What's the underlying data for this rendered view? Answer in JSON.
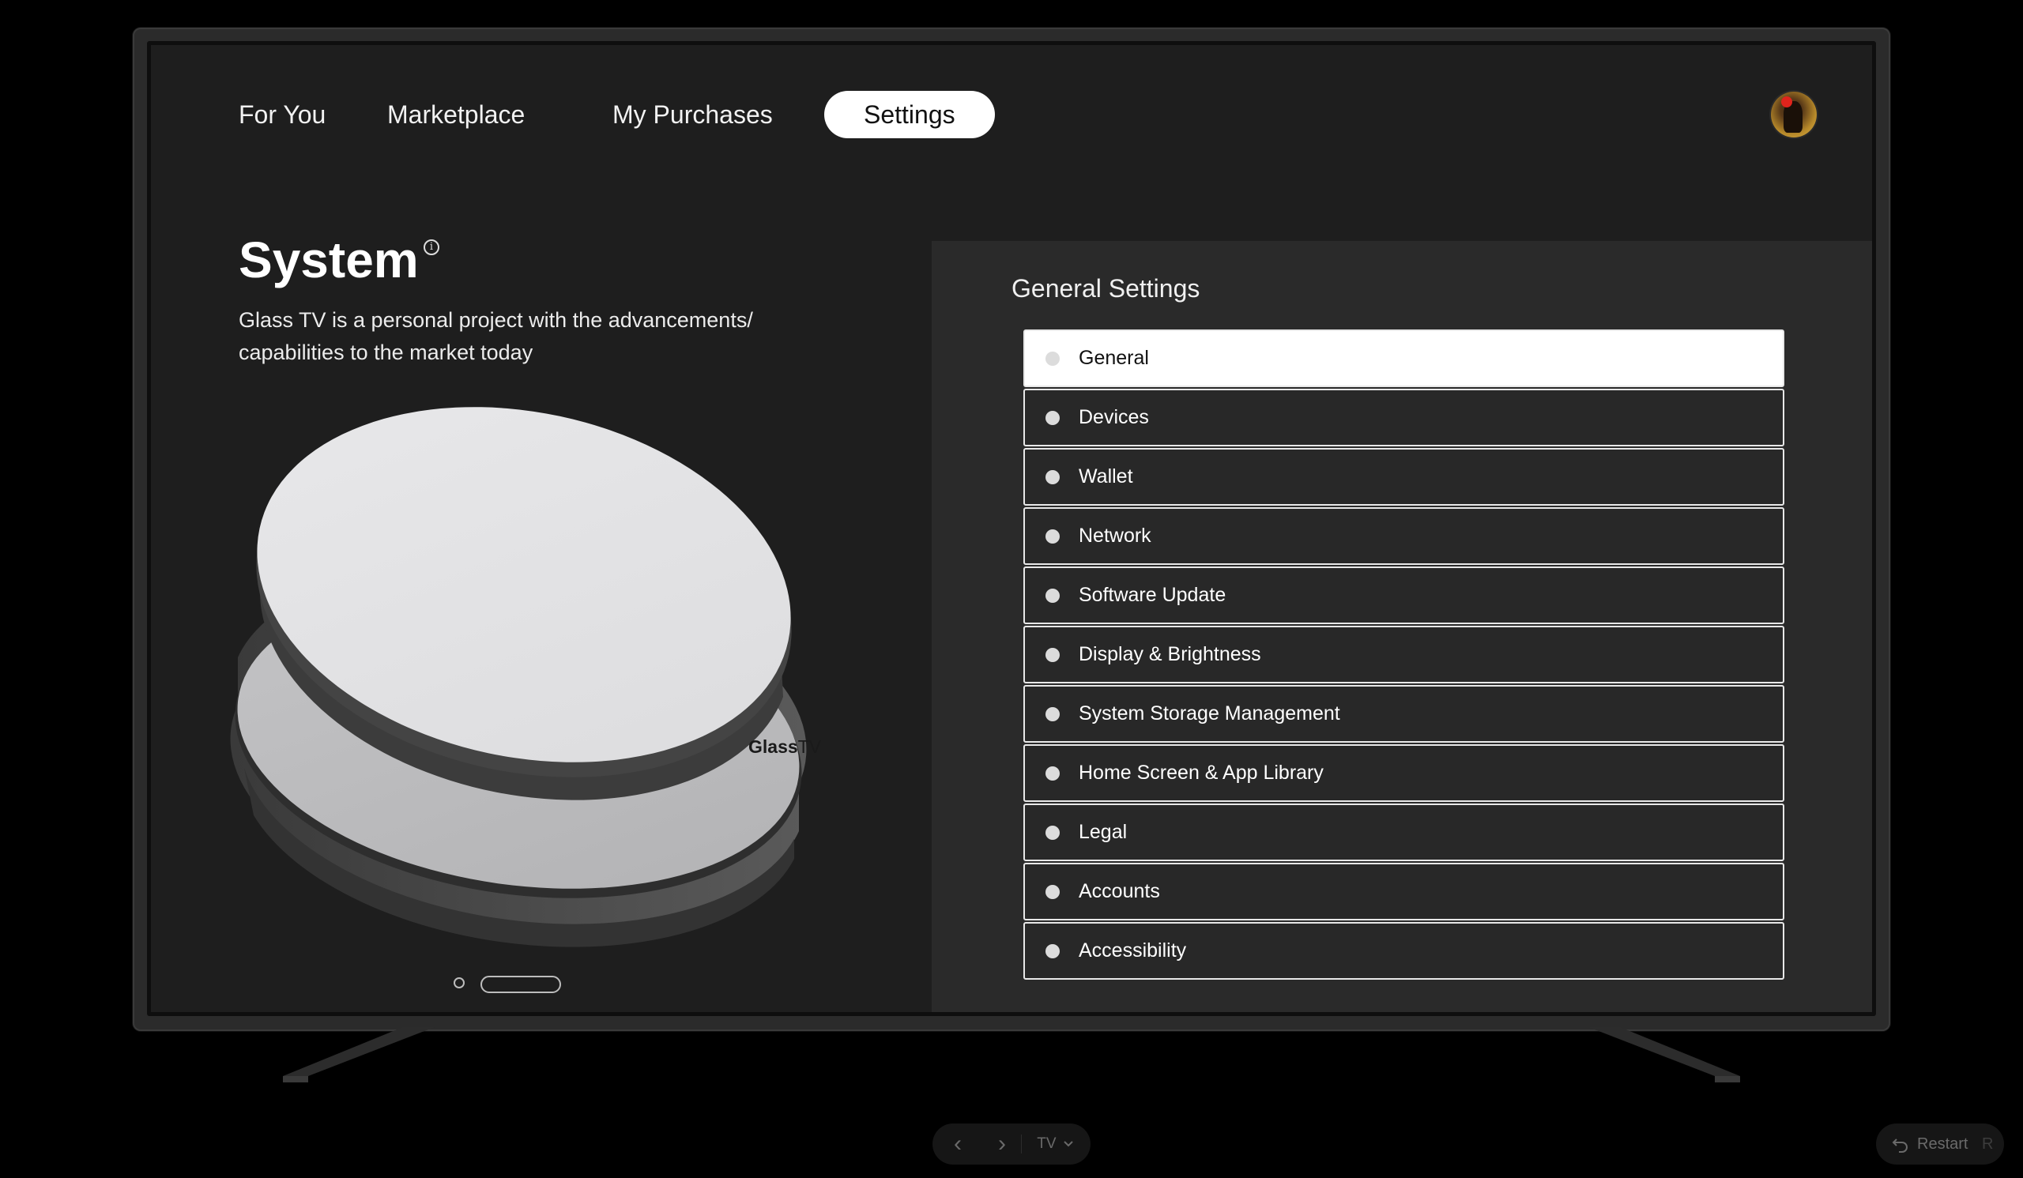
{
  "nav": {
    "tabs": [
      {
        "label": "For You"
      },
      {
        "label": "Marketplace"
      },
      {
        "label": "My Purchases"
      },
      {
        "label": "Settings",
        "active": true
      }
    ]
  },
  "system": {
    "title": "System",
    "info_icon_glyph": "i",
    "description": "Glass TV is a personal project with the advancements/ capabilities to the market today",
    "device_logo_bold": "Glass",
    "device_logo_light": "TV"
  },
  "settings": {
    "section_title": "General Settings",
    "items": [
      {
        "label": "General",
        "selected": true
      },
      {
        "label": "Devices"
      },
      {
        "label": "Wallet"
      },
      {
        "label": "Network"
      },
      {
        "label": "Software Update"
      },
      {
        "label": "Display & Brightness"
      },
      {
        "label": "System Storage Management"
      },
      {
        "label": "Home Screen & App Library"
      },
      {
        "label": "Legal"
      },
      {
        "label": "Accounts"
      },
      {
        "label": "Accessibility"
      }
    ]
  },
  "controls": {
    "prev_glyph": "‹",
    "next_glyph": "›",
    "device_select": "TV",
    "restart_label": "Restart",
    "restart_shortcut": "R"
  },
  "colors": {
    "screen_bg": "#1e1e1e",
    "panel_bg": "#2a2a2a",
    "active_tab_bg": "#ffffff",
    "avatar_dot": "#e0241c"
  },
  "icons": {
    "info": "info-icon",
    "avatar": "user-avatar",
    "prev": "chevron-left-icon",
    "next": "chevron-right-icon",
    "dropdown": "chevron-down-icon",
    "restart": "restart-icon"
  }
}
